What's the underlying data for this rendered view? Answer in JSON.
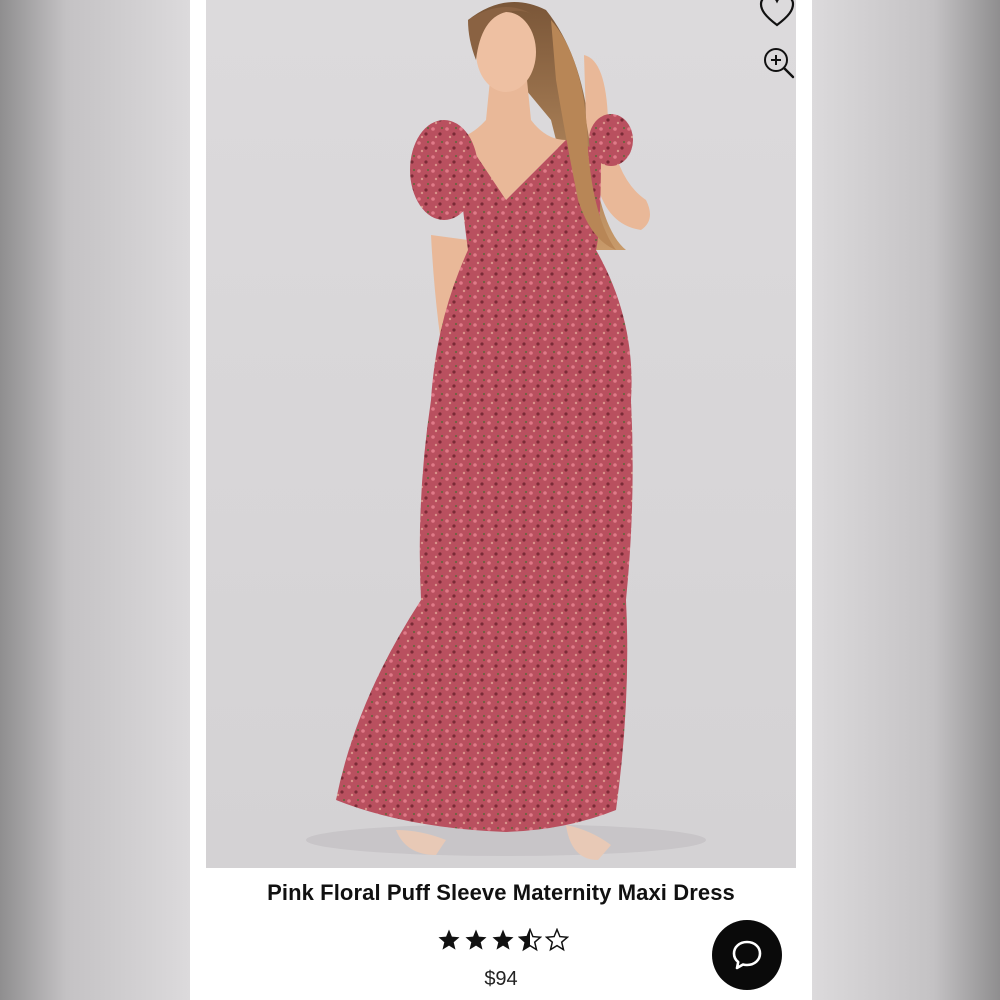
{
  "product": {
    "title": "Pink Floral Puff Sleeve Maternity Maxi Dress",
    "price": "$94",
    "rating": 3.5,
    "rating_max": 5,
    "image_alt": "Model wearing pink floral puff sleeve maxi dress"
  },
  "icons": {
    "wishlist": "heart-icon",
    "zoom": "zoom-in-icon",
    "chat": "chat-bubble-icon"
  },
  "colors": {
    "dress": "#b8505e",
    "background": "#d9d7d9",
    "chat_button": "#0a0a0a",
    "star": "#111111"
  }
}
